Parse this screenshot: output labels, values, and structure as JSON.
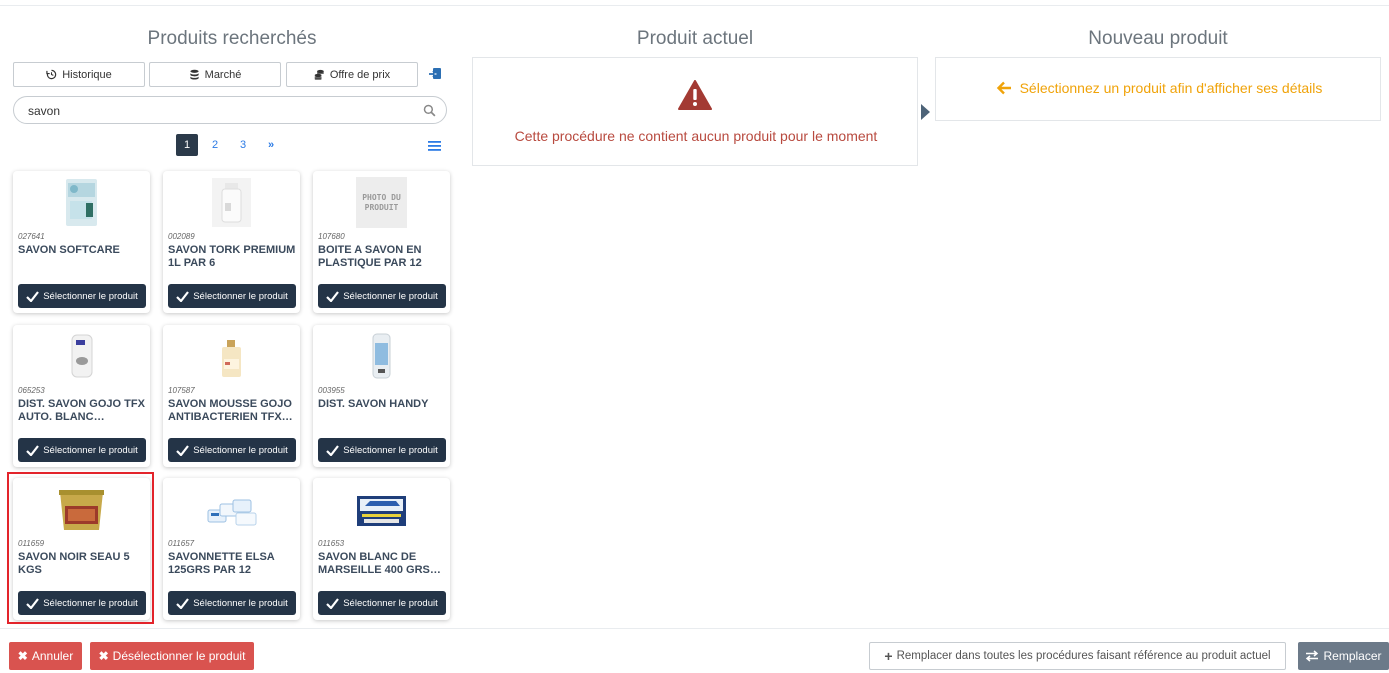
{
  "columns": {
    "left_title": "Produits recherchés",
    "middle_title": "Produit actuel",
    "right_title": "Nouveau produit"
  },
  "toolbar": {
    "history_label": "Historique",
    "market_label": "Marché",
    "offer_label": "Offre de prix"
  },
  "search": {
    "value": "savon"
  },
  "pagination": {
    "pages": [
      "1",
      "2",
      "3"
    ],
    "next": "»",
    "active": "1"
  },
  "products": [
    {
      "code": "027641",
      "name": "SAVON SOFTCARE",
      "select_label": "Sélectionner le produit"
    },
    {
      "code": "002089",
      "name": "SAVON TORK PREMIUM 1L PAR 6",
      "select_label": "Sélectionner le produit"
    },
    {
      "code": "107680",
      "name": "BOITE A SAVON EN PLASTIQUE PAR 12",
      "select_label": "Sélectionner le produit",
      "placeholder_text": "PHOTO DU PRODUIT"
    },
    {
      "code": "065253",
      "name": "DIST. SAVON GOJO TFX AUTO. BLANC…",
      "select_label": "Sélectionner le produit"
    },
    {
      "code": "107587",
      "name": "SAVON MOUSSE GOJO ANTIBACTERIEN TFX…",
      "select_label": "Sélectionner le produit"
    },
    {
      "code": "003955",
      "name": "DIST. SAVON HANDY",
      "select_label": "Sélectionner le produit"
    },
    {
      "code": "011659",
      "name": "SAVON NOIR SEAU 5 KGS",
      "select_label": "Sélectionner le produit"
    },
    {
      "code": "011657",
      "name": "SAVONNETTE ELSA 125GRS PAR 12",
      "select_label": "Sélectionner le produit"
    },
    {
      "code": "011653",
      "name": "SAVON BLANC DE MARSEILLE 400 GRS…",
      "select_label": "Sélectionner le produit"
    }
  ],
  "current_product": {
    "message": "Cette procédure ne contient aucun produit pour le moment"
  },
  "new_product": {
    "hint": "Sélectionnez un produit afin d'afficher ses détails"
  },
  "footer": {
    "cancel_label": "Annuler",
    "deselect_label": "Désélectionner le produit",
    "replace_all_label": "Remplacer dans toutes les procédures faisant référence au produit actuel",
    "replace_label": "Remplacer"
  },
  "colors": {
    "danger": "#d9534f",
    "warning_text": "#f0a30a",
    "dark_button": "#243447",
    "highlight": "#e3242b"
  }
}
